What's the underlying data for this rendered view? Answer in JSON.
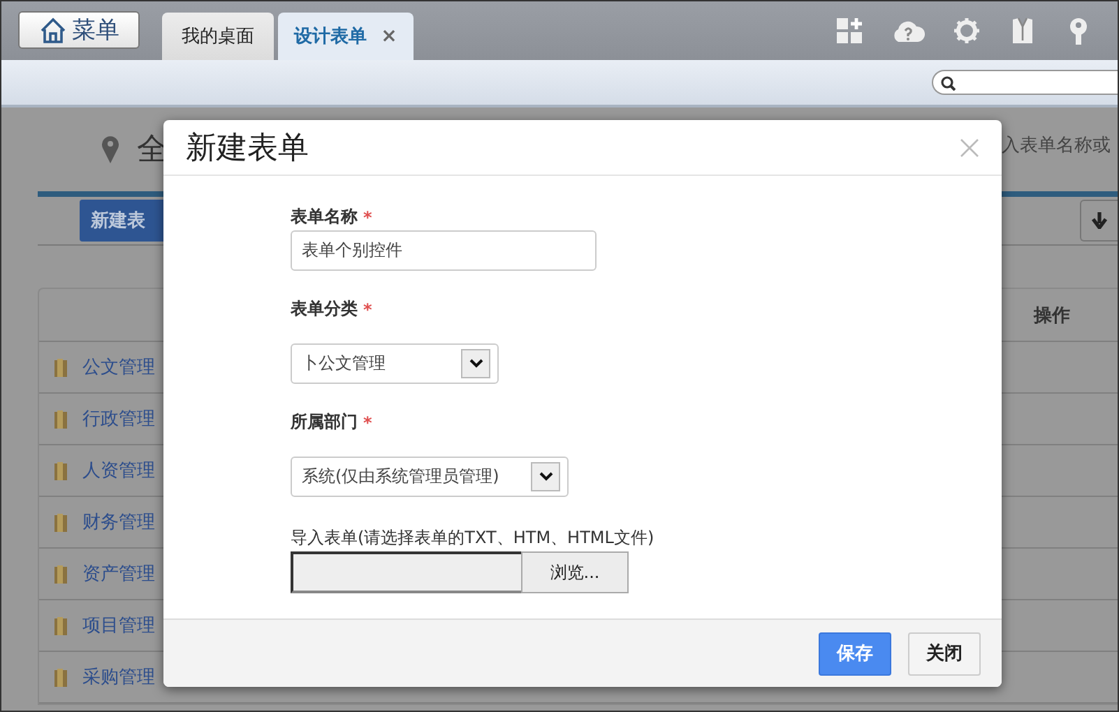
{
  "top_bar": {
    "menu_button": "菜单",
    "tabs": [
      {
        "label": "我的桌面",
        "selected": false
      },
      {
        "label": "设计表单",
        "selected": true,
        "close": "×"
      }
    ]
  },
  "page": {
    "location_title": "全",
    "search_hint": "入表单名称或",
    "new_button": "新建表",
    "action_column": "操作",
    "categories": [
      {
        "label": "公文管理"
      },
      {
        "label": "行政管理"
      },
      {
        "label": "人资管理"
      },
      {
        "label": "财务管理"
      },
      {
        "label": "资产管理"
      },
      {
        "label": "项目管理"
      },
      {
        "label": "采购管理"
      }
    ]
  },
  "dialog": {
    "title": "新建表单",
    "fields": [
      {
        "kind": "text",
        "label": "表单名称",
        "required_mark": "*",
        "value": "表单个别控件"
      },
      {
        "kind": "select",
        "label": "表单分类",
        "required_mark": "*",
        "value": "卜公文管理"
      },
      {
        "kind": "select",
        "label": "所属部门",
        "required_mark": "*",
        "value": "系统(仅由系统管理员管理)"
      },
      {
        "kind": "file",
        "label": "导入表单(请选择表单的TXT、HTM、HTML文件)",
        "button": "浏览..."
      }
    ],
    "buttons": [
      {
        "label": "保存",
        "kind": "primary"
      },
      {
        "label": "关闭",
        "kind": "default"
      }
    ]
  }
}
